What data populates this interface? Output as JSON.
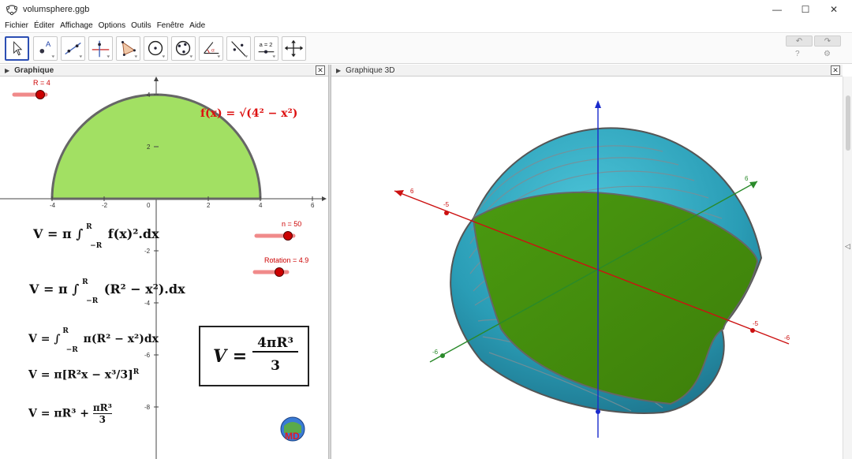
{
  "window": {
    "title": "volumsphere.ggb",
    "minimize_icon": "—",
    "maximize_icon": "☐",
    "close_icon": "✕"
  },
  "menu": [
    "Fichier",
    "Éditer",
    "Affichage",
    "Options",
    "Outils",
    "Fenêtre",
    "Aide"
  ],
  "toolbar": {
    "tools": [
      "move-tool",
      "point-tool",
      "line-tool",
      "perpendicular-tool",
      "polygon-tool",
      "circle-tool",
      "conic-tool",
      "angle-tool",
      "reflect-tool",
      "slider-tool",
      "move-view-tool"
    ],
    "slider_tool_label": "a = 2",
    "undo_icon": "↶",
    "redo_icon": "↷",
    "help_icon": "?",
    "settings_icon": "⚙"
  },
  "graphics_view": {
    "title": "Graphique",
    "close_icon": "✕",
    "x_ticks": [
      "-4",
      "-2",
      "0",
      "2",
      "4",
      "6"
    ],
    "y_ticks": [
      "4",
      "2",
      "-2",
      "-4",
      "-6",
      "-8"
    ],
    "function_label": "f(x) = √(4² − x²)",
    "sliders": [
      {
        "label": "R = 4",
        "value": 4
      },
      {
        "label": "n = 50",
        "value": 50
      },
      {
        "label": "Rotation = 4.9",
        "value": 4.9
      }
    ],
    "formulas": {
      "f1_prefix": "V = π ∫",
      "f1_body": "f(x)².dx",
      "f2_prefix": "V = π ∫",
      "f2_body": "(R² − x²).dx",
      "f3_prefix": "V = ∫",
      "f3_body": "π(R² − x²)dx",
      "f4_text": "V = π[R²x − x³/3]",
      "f5_prefix": "V = πR³ +",
      "upper_limit": "R",
      "lower_limit": "−R",
      "frac_num": "x³",
      "frac_den": "3",
      "f5_num": "πR³",
      "f5_den": "3",
      "box_lhs": "V =",
      "box_num": "4πR³",
      "box_den": "3"
    },
    "logo_text": "MD"
  },
  "graphics3d_view": {
    "title": "Graphique 3D",
    "close_icon": "✕",
    "axis_labels": [
      "6",
      "-5",
      "6",
      "-5",
      "-6",
      "-6"
    ]
  },
  "colors": {
    "semicircle_fill": "#a2e063",
    "sphere_fill": "#2aa6bf",
    "cut_fill": "#5aa010",
    "accent_red": "#cc0000"
  }
}
